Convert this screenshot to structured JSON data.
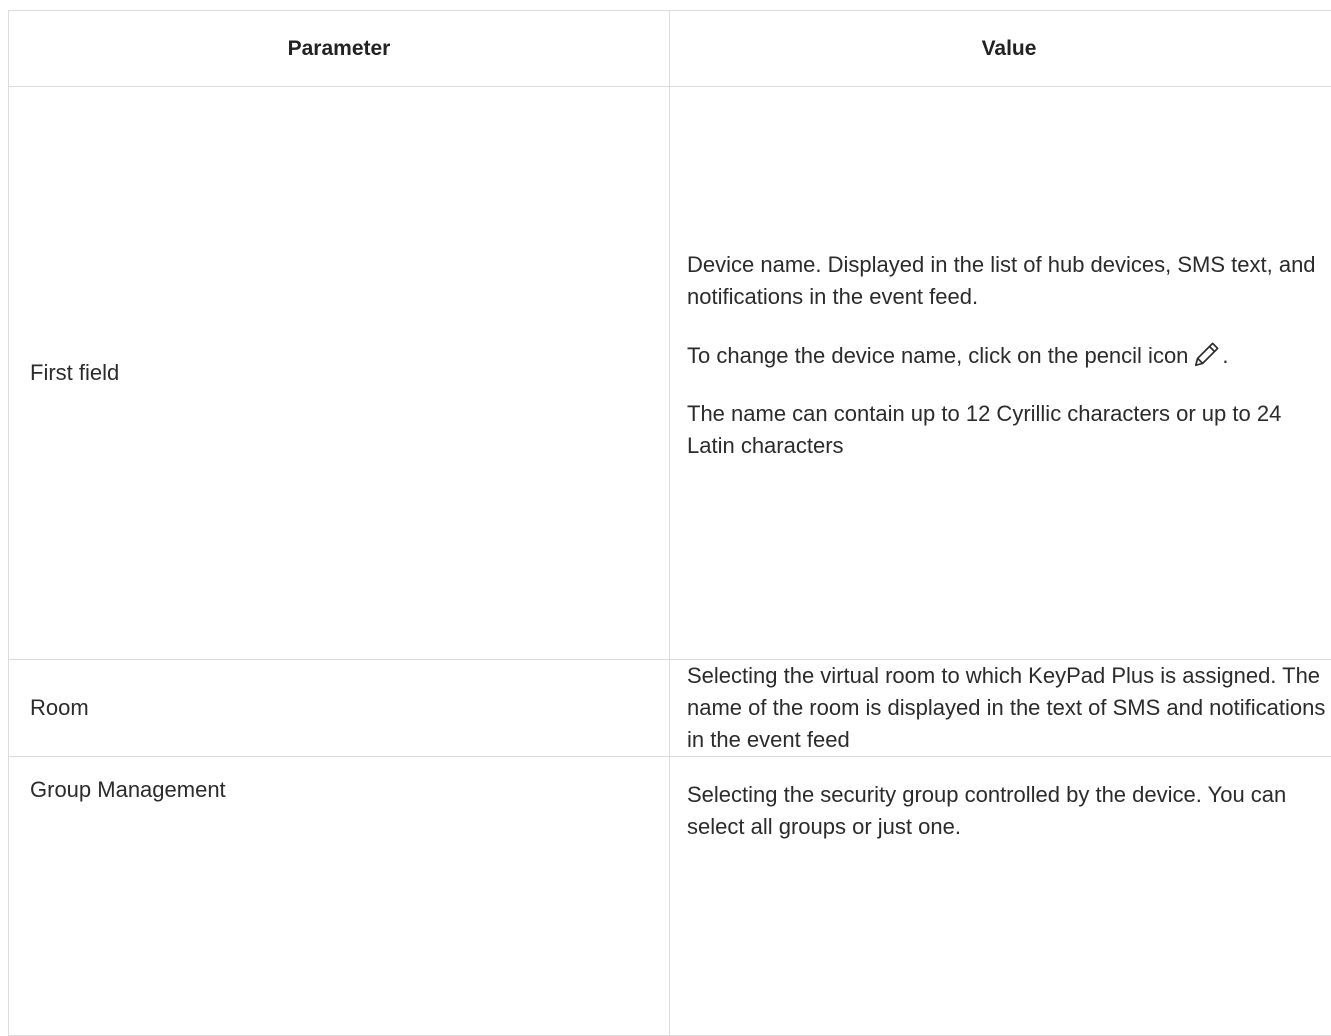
{
  "table": {
    "headers": {
      "parameter": "Parameter",
      "value": "Value"
    },
    "rows": [
      {
        "parameter": "First field",
        "value_paragraphs": [
          "Device name. Displayed in the list of hub devices, SMS text, and notifications in the event feed.",
          "To change the device name, click on the pencil icon",
          "The name can contain up to 12 Cyrillic characters or up to 24 Latin characters"
        ],
        "pencil_suffix": ".",
        "icon": "pencil-icon"
      },
      {
        "parameter": "Room",
        "value": "Selecting the virtual room to which KeyPad Plus is assigned. The name of the room is displayed in the text of SMS and notifications in the event feed"
      },
      {
        "parameter": "Group Management",
        "value": "Selecting the security group controlled by the device. You can select all groups or just one."
      }
    ]
  }
}
